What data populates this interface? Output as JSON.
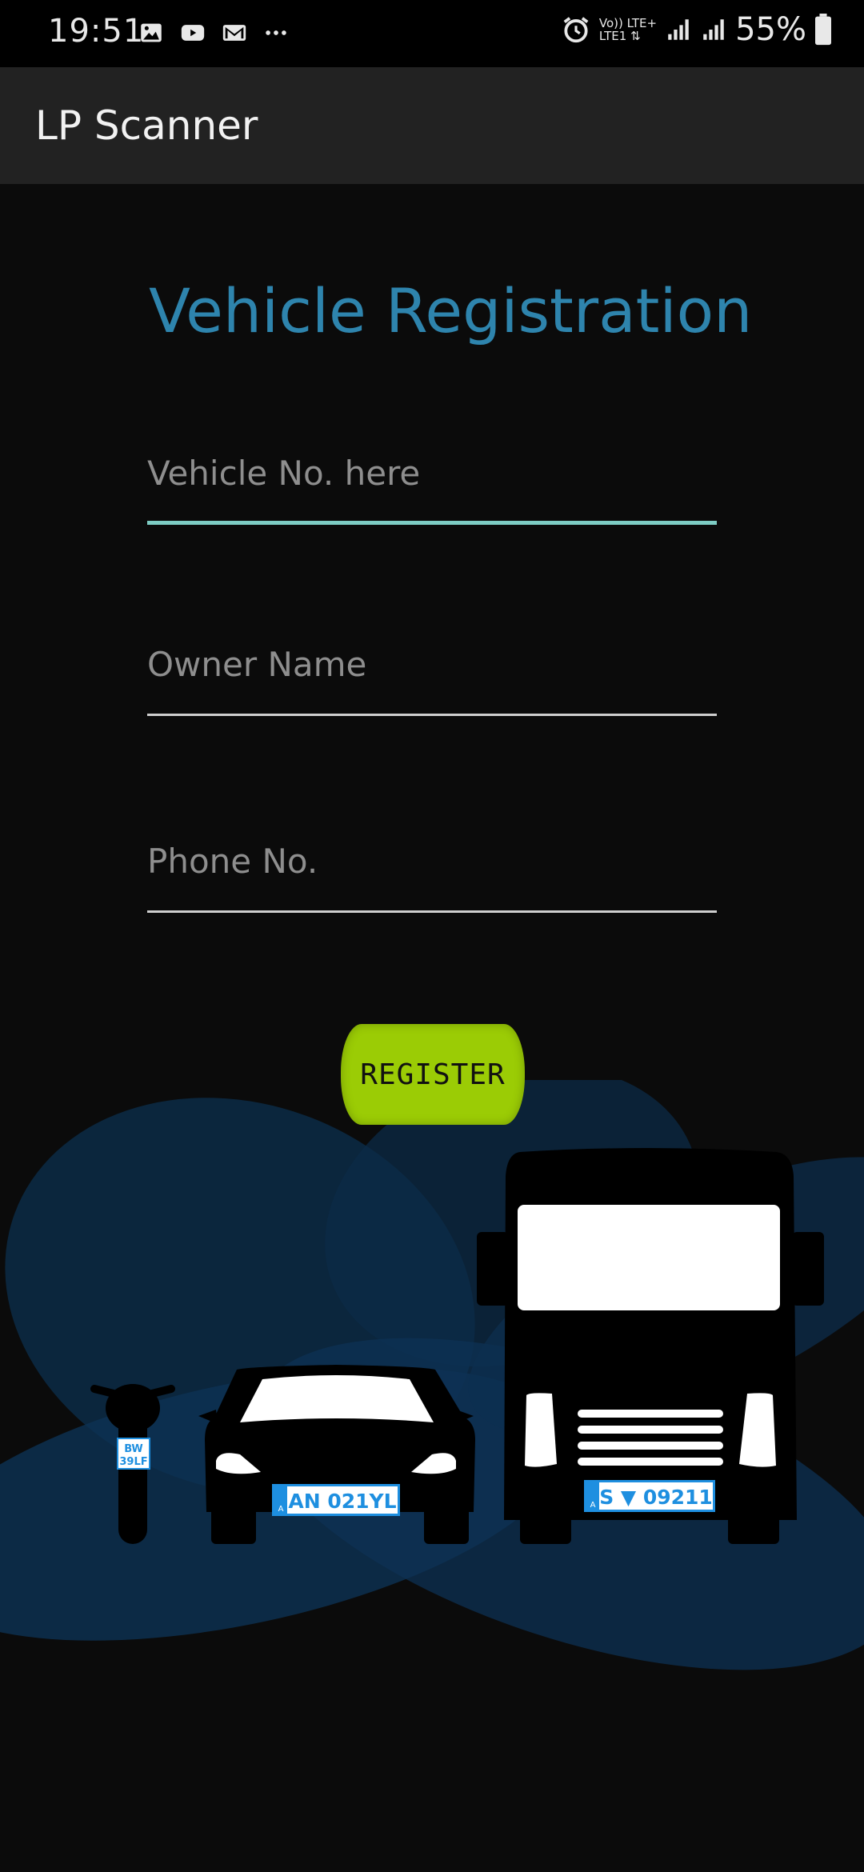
{
  "status_bar": {
    "time": "19:51",
    "network_line1": "Vo)) LTE+",
    "network_line2": "LTE1 ⇅",
    "battery": "55%",
    "icons": [
      "gallery-icon",
      "youtube-icon",
      "gmail-icon",
      "more-icon",
      "alarm-icon",
      "signal-icon",
      "signal-icon-2",
      "battery-icon"
    ]
  },
  "app_bar": {
    "title": "LP Scanner"
  },
  "form": {
    "heading": "Vehicle Registration",
    "vehicle_no": {
      "placeholder": "Vehicle No. here",
      "value": ""
    },
    "owner_name": {
      "placeholder": "Owner Name",
      "value": ""
    },
    "phone_no": {
      "placeholder": "Phone No.",
      "value": ""
    },
    "register_label": "REGISTER"
  },
  "illustration": {
    "motorcycle_plate_line1": "BW",
    "motorcycle_plate_line2": "39LF",
    "car_plate": "AN 021YL",
    "car_plate_country": "A",
    "truck_plate": "S ▼ 09211",
    "truck_plate_country": "A"
  },
  "colors": {
    "accent": "#2e84ad",
    "button": "#9bcc05",
    "focus_line": "#7ecdc4",
    "plate_blue": "#1e8fe0"
  }
}
